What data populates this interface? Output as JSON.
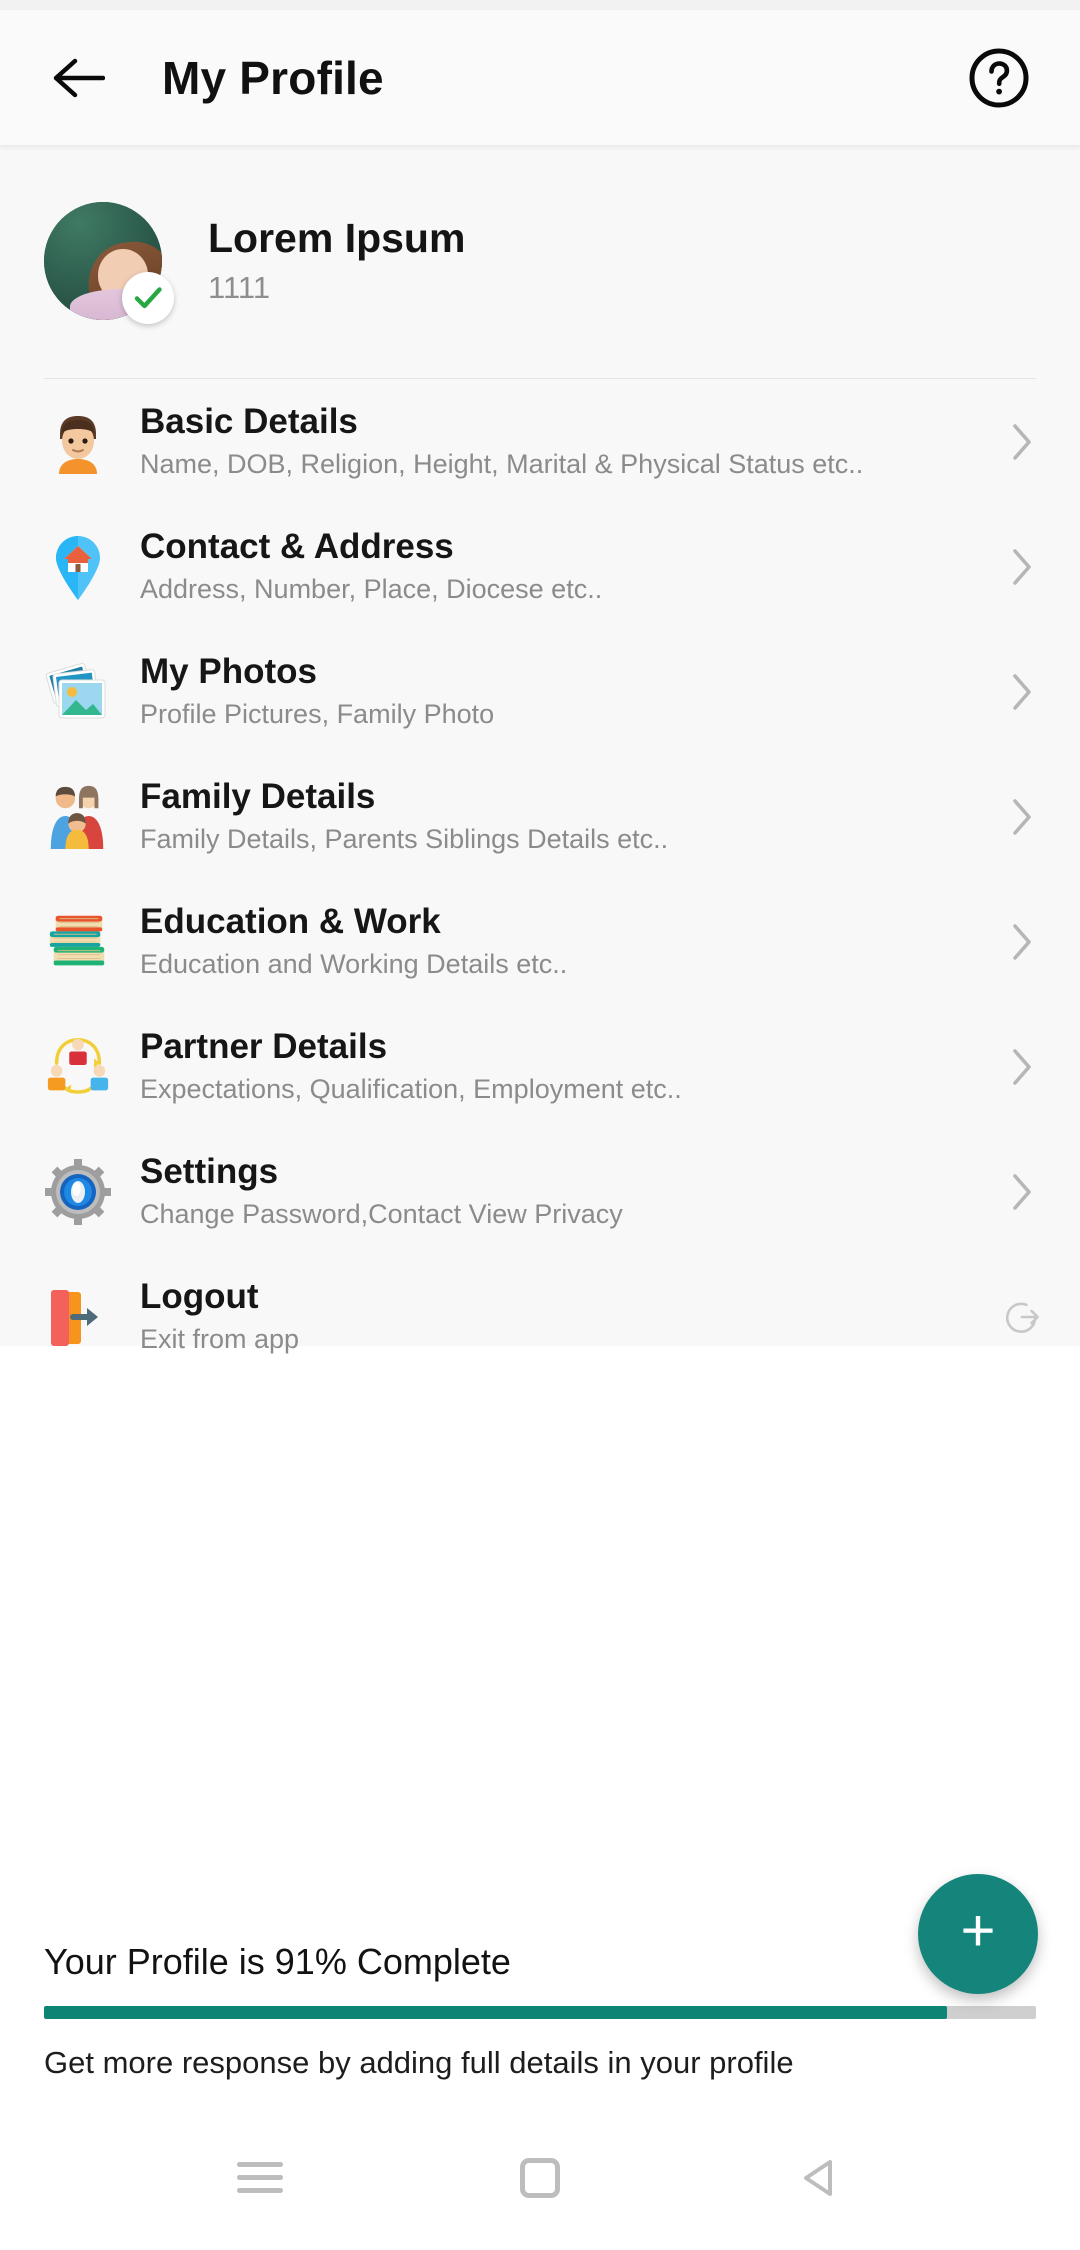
{
  "header": {
    "title": "My Profile",
    "back_icon": "arrow-left-icon",
    "help_icon": "help-circle-icon"
  },
  "profile": {
    "name": "Lorem Ipsum",
    "id": "1111",
    "verified_icon": "check-badge-icon",
    "avatar_alt": "profile-photo"
  },
  "menu": {
    "items": [
      {
        "icon": "person-face-icon",
        "title": "Basic Details",
        "subtitle": "Name, DOB, Religion, Height, Marital & Physical Status etc..",
        "chevron": "chevron-right-icon"
      },
      {
        "icon": "map-pin-home-icon",
        "title": "Contact & Address",
        "subtitle": "Address, Number, Place, Diocese etc..",
        "chevron": "chevron-right-icon"
      },
      {
        "icon": "photos-stack-icon",
        "title": "My Photos",
        "subtitle": "Profile Pictures, Family Photo",
        "chevron": "chevron-right-icon"
      },
      {
        "icon": "family-group-icon",
        "title": "Family Details",
        "subtitle": "Family Details, Parents Siblings Details etc..",
        "chevron": "chevron-right-icon"
      },
      {
        "icon": "books-stack-icon",
        "title": "Education & Work",
        "subtitle": "Education and Working Details etc..",
        "chevron": "chevron-right-icon"
      },
      {
        "icon": "partner-network-icon",
        "title": "Partner Details",
        "subtitle": "Expectations, Qualification, Employment etc..",
        "chevron": "chevron-right-icon"
      },
      {
        "icon": "gear-settings-icon",
        "title": "Settings",
        "subtitle": "Change Password,Contact View Privacy",
        "chevron": "chevron-right-icon"
      },
      {
        "icon": "logout-door-icon",
        "title": "Logout",
        "subtitle": "Exit from app",
        "chevron": "logout-arrow-icon"
      }
    ]
  },
  "footer": {
    "completion_text": "Your Profile is 91% Complete",
    "completion_percent": 91,
    "caption": "Get more response by adding full details in your profile",
    "progress_color": "#0e8474",
    "track_color": "#cfcfcf"
  },
  "fab": {
    "label": "+",
    "icon": "plus-icon",
    "color": "#15857c"
  },
  "navbar": {
    "recents_icon": "menu-lines-icon",
    "home_icon": "home-square-icon",
    "back_icon": "back-triangle-icon"
  }
}
